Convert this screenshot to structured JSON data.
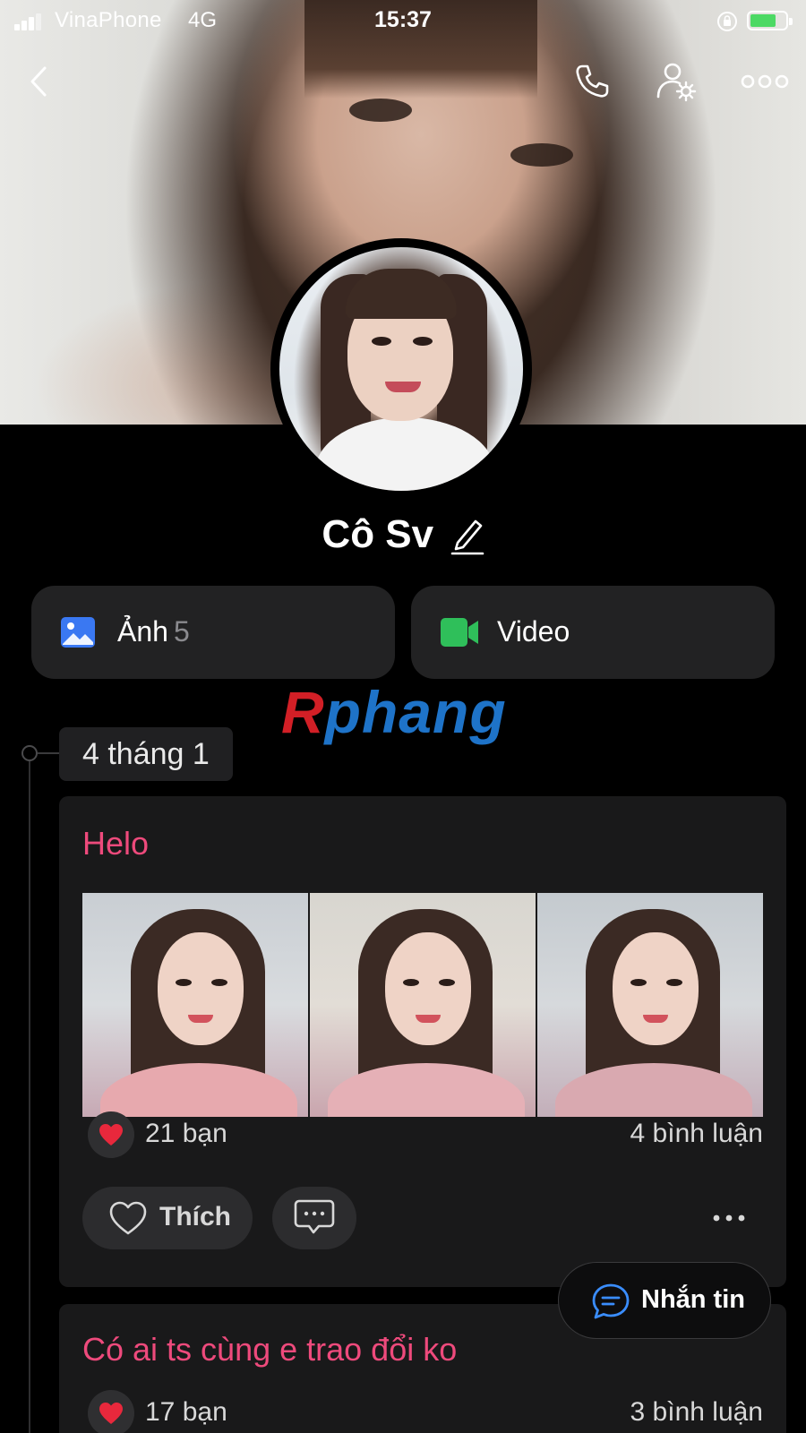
{
  "status_bar": {
    "carrier": "VinaPhone",
    "network": "4G",
    "time": "15:37",
    "battery_icon": "battery-charging-icon",
    "accent_battery": "#4cd964"
  },
  "nav": {
    "back_icon": "chevron-left-icon",
    "call_icon": "phone-icon",
    "settings_icon": "user-settings-icon",
    "more_icon": "ellipsis-icon"
  },
  "profile": {
    "name": "Cô Sv"
  },
  "media": {
    "photos_label": "Ảnh",
    "photos_count": "5",
    "video_label": "Video",
    "photo_color": "#3a78f2",
    "video_color": "#2fbf5a"
  },
  "watermark": {
    "first": "R",
    "rest": "phang"
  },
  "timeline": {
    "date": "4 tháng 1"
  },
  "posts": [
    {
      "title": "Helo",
      "reactions": "21 bạn",
      "comments": "4 bình luận",
      "like_label": "Thích"
    },
    {
      "title": "Có ai ts cùng e trao đổi ko",
      "reactions": "17 bạn",
      "comments": "3 bình luận"
    }
  ],
  "message_button": {
    "label": "Nhắn tin"
  },
  "colors": {
    "post_title": "#ee4a7c",
    "heart": "#e8283c",
    "card_bg": "#19191a"
  }
}
